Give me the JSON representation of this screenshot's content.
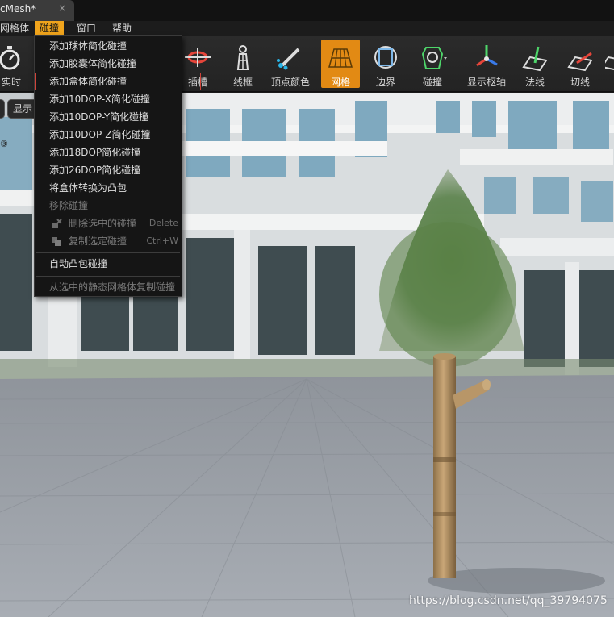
{
  "tab": {
    "title": "cMesh*",
    "close": "×"
  },
  "menubar": {
    "items": [
      {
        "label": "网格体"
      },
      {
        "label": "碰撞"
      },
      {
        "label": "窗口"
      },
      {
        "label": "帮助"
      }
    ],
    "active": "碰撞",
    "accent_color": "#f0a41c"
  },
  "toolbar": {
    "buttons": [
      {
        "label": "实时",
        "icon": "stopwatch-icon"
      },
      {
        "label": "插槽",
        "icon": "socket-icon"
      },
      {
        "label": "线框",
        "icon": "wireframe-icon"
      },
      {
        "label": "顶点颜色",
        "icon": "vertex-color-icon"
      },
      {
        "label": "网格",
        "icon": "grid-icon",
        "selected": true
      },
      {
        "label": "边界",
        "icon": "bounds-icon"
      },
      {
        "label": "碰撞",
        "icon": "collision-icon"
      },
      {
        "label": "显示枢轴",
        "icon": "pivot-icon"
      },
      {
        "label": "法线",
        "icon": "normals-icon"
      },
      {
        "label": "切线",
        "icon": "tangents-icon"
      }
    ],
    "selected_color": "#e28a14"
  },
  "viewport": {
    "show_button": "显示",
    "side_glyph": "③",
    "watermark": "https://blog.csdn.net/qq_39794075"
  },
  "dropdown": {
    "items": [
      {
        "label": "添加球体简化碰撞"
      },
      {
        "label": "添加胶囊体简化碰撞"
      },
      {
        "label": "添加盒体简化碰撞",
        "highlighted": true
      },
      {
        "label": "添加10DOP-X简化碰撞"
      },
      {
        "label": "添加10DOP-Y简化碰撞"
      },
      {
        "label": "添加10DOP-Z简化碰撞"
      },
      {
        "label": "添加18DOP简化碰撞"
      },
      {
        "label": "添加26DOP简化碰撞"
      },
      {
        "label": "将盒体转换为凸包"
      },
      {
        "label": "移除碰撞",
        "disabled": true
      },
      {
        "label": "删除选中的碰撞",
        "shortcut": "Delete",
        "disabled": true,
        "icon": "delete-collision-icon"
      },
      {
        "label": "复制选定碰撞",
        "shortcut": "Ctrl+W",
        "disabled": true,
        "icon": "duplicate-collision-icon"
      },
      {
        "label": "自动凸包碰撞"
      },
      {
        "label": "从选中的静态网格体复制碰撞",
        "disabled": true
      }
    ],
    "highlight_color": "#d0443a"
  }
}
